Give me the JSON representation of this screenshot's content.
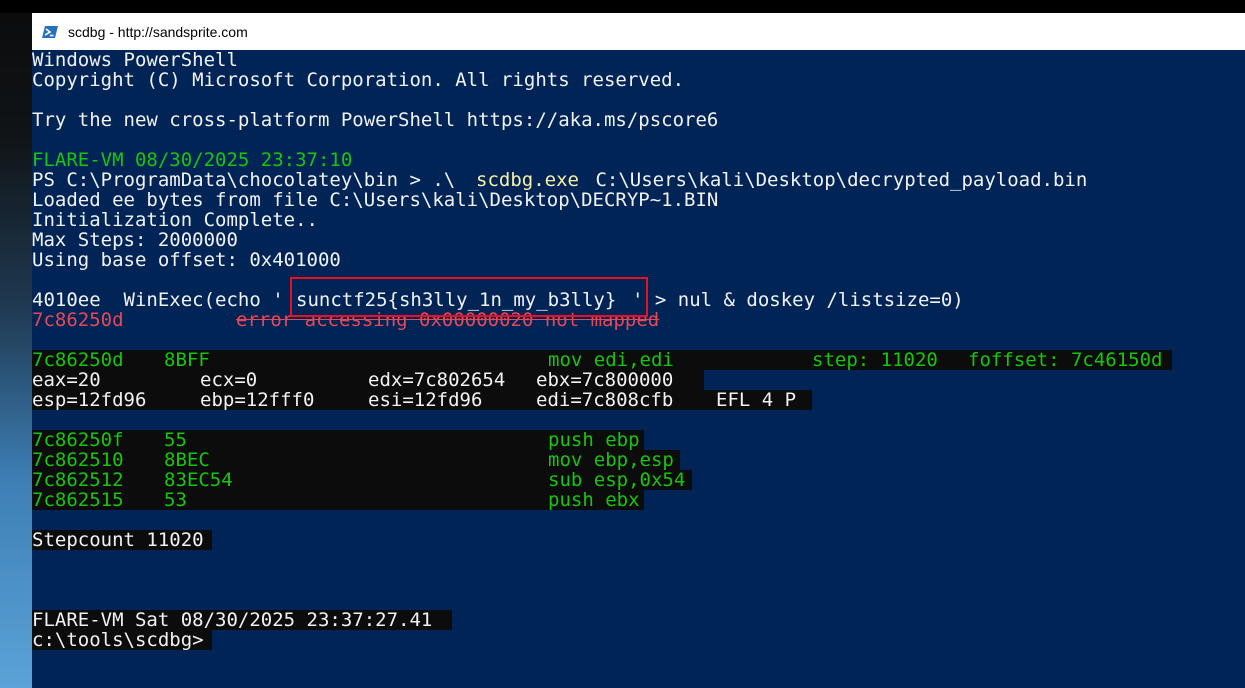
{
  "window": {
    "title": "scdbg - http://sandsprite.com",
    "icon": "powershell-icon"
  },
  "console": {
    "header1": "Windows PowerShell",
    "header2": "Copyright (C) Microsoft Corporation. All rights reserved.",
    "try_line": "Try the new cross-platform PowerShell https://aka.ms/pscore6",
    "prompt_time": "FLARE-VM 08/30/2025 23:37:10",
    "cmd_prefix": "PS C:\\ProgramData\\chocolatey\\bin > .\\",
    "cmd_exe": "scdbg.exe",
    "cmd_arg": " C:\\Users\\kali\\Desktop\\decrypted_payload.bin",
    "loaded": "Loaded ee bytes from file C:\\Users\\kali\\Desktop\\DECRYP~1.BIN",
    "init": "Initialization Complete..",
    "max_steps": "Max Steps: 2000000",
    "base_offset": "Using base offset: 0x401000",
    "winexec_prefix": "4010ee  WinExec(echo '",
    "flag": "sunctf25{sh3lly_1n_my_b3lly}",
    "winexec_suffix": "' > nul & doskey /listsize=0)",
    "err_addr": "7c86250d",
    "err_msg": "error accessing 0x00000020 not mapped",
    "dis1_addr": "7c86250d",
    "dis1_bytes": "8BFF",
    "dis1_instr": "mov edi,edi",
    "dis1_step": "step: 11020",
    "dis1_foffset": "foffset: 7c46150d",
    "reg_eax": "eax=20",
    "reg_ecx": "ecx=0",
    "reg_edx": "edx=7c802654",
    "reg_ebx": "ebx=7c800000",
    "reg_esp": "esp=12fd96",
    "reg_ebp": "ebp=12fff0",
    "reg_esi": "esi=12fd96",
    "reg_edi": "edi=7c808cfb",
    "reg_efl": "EFL 4 P",
    "disasm": [
      {
        "addr": "7c86250f",
        "bytes": "55",
        "instr": "push ebp"
      },
      {
        "addr": "7c862510",
        "bytes": "8BEC",
        "instr": "mov ebp,esp"
      },
      {
        "addr": "7c862512",
        "bytes": "83EC54",
        "instr": "sub esp,0x54"
      },
      {
        "addr": "7c862515",
        "bytes": "53",
        "instr": "push ebx"
      }
    ],
    "stepcount": "Stepcount 11020",
    "final_prompt": "FLARE-VM Sat 08/30/2025 23:37:27.41",
    "cwd": "c:\\tools\\scdbg>"
  }
}
